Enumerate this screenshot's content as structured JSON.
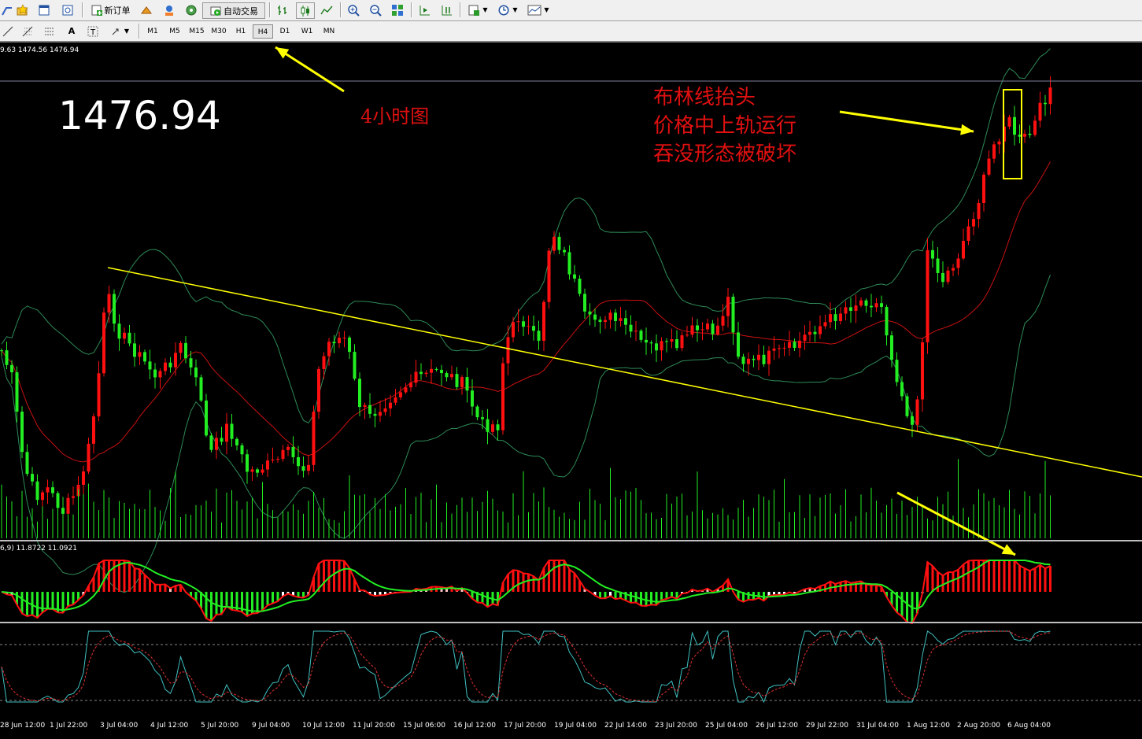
{
  "toolbar": {
    "new_order_label": "新订单",
    "auto_trade_label": "自动交易"
  },
  "timeframes": [
    "M1",
    "M5",
    "M15",
    "M30",
    "H1",
    "H4",
    "D1",
    "W1",
    "MN"
  ],
  "active_timeframe": "H4",
  "chart": {
    "ohlc_header": "9.63 1474.56 1476.94",
    "current_price": "1476.94",
    "macd_header": "6,9) 11.8722 11.0921",
    "colors": {
      "bull": "#ff1010",
      "bear": "#22ee22",
      "trendline": "#ffff00",
      "band": "#2e8b57",
      "mid": "#cc1111"
    },
    "x_labels": [
      "28 Jun 12:00",
      "1 Jul 22:00",
      "3 Jul 04:00",
      "4 Jul 12:00",
      "5 Jul 20:00",
      "9 Jul 04:00",
      "10 Jul 12:00",
      "11 Jul 20:00",
      "15 Jul 06:00",
      "16 Jul 12:00",
      "17 Jul 20:00",
      "19 Jul 04:00",
      "22 Jul 14:00",
      "23 Jul 20:00",
      "25 Jul 04:00",
      "26 Jul 12:00",
      "29 Jul 22:00",
      "31 Jul 04:00",
      "1 Aug 12:00",
      "2 Aug 20:00",
      "6 Aug 04:00"
    ]
  },
  "annotations": {
    "timeframe_note": "4小时图",
    "line1": "布林线抬头",
    "line2": "价格中上轨运行",
    "line3": "吞没形态被破坏"
  }
}
